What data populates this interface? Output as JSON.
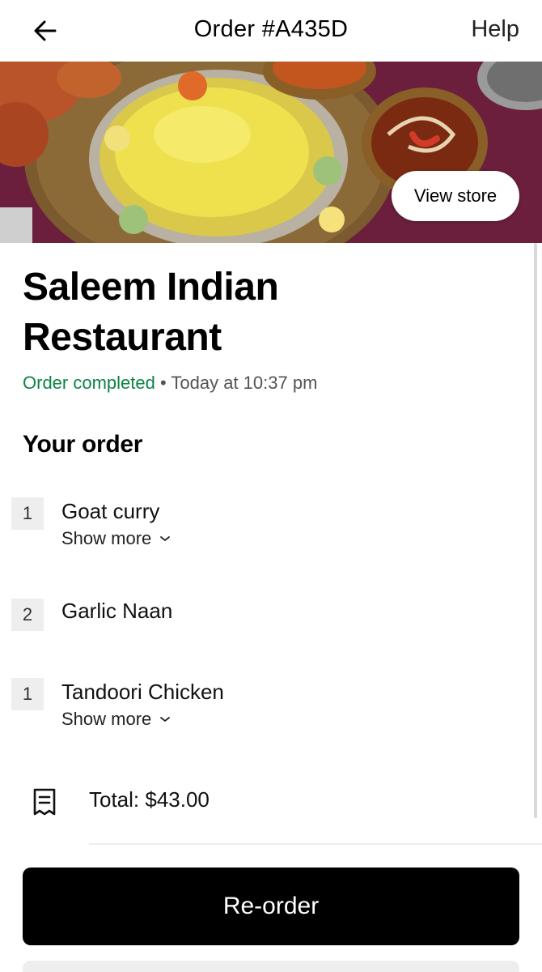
{
  "header": {
    "title": "Order #A435D",
    "help_label": "Help",
    "back_icon": "arrow-left-icon"
  },
  "hero": {
    "view_store_label": "View store"
  },
  "restaurant": {
    "name": "Saleem Indian Restaurant",
    "status": "Order completed",
    "separator": " • ",
    "time": "Today at 10:37 pm"
  },
  "order": {
    "section_title": "Your order",
    "items": [
      {
        "qty": "1",
        "name": "Goat curry",
        "show_more": "Show more"
      },
      {
        "qty": "2",
        "name": "Garlic Naan"
      },
      {
        "qty": "1",
        "name": "Tandoori Chicken",
        "show_more": "Show more"
      }
    ],
    "total": "Total: $43.00"
  },
  "actions": {
    "reorder_label": "Re-order"
  },
  "colors": {
    "status_green": "#0e8345",
    "button_black": "#000000"
  }
}
